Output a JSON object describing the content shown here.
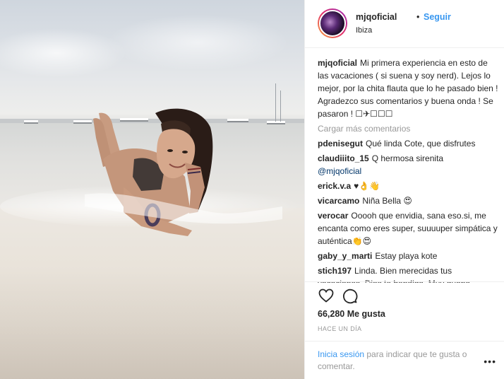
{
  "header": {
    "username": "mjqoficial",
    "separator": "•",
    "follow_label": "Seguir",
    "location": "Ibiza"
  },
  "caption": {
    "username": "mjqoficial",
    "text": "Mi primera experiencia en esto de las vacaciones ( si suena y soy nerd). Lejos lo mejor, por la chita flauta que lo he pasado bien ! Agradezco sus comentarios y buena onda ! Se pasaron ! ☐✈☐☐☐"
  },
  "load_more_label": "Cargar más comentarios",
  "comments": [
    {
      "username": "pdenisegut",
      "text": "Qué linda Cote, que disfrutes",
      "mention": ""
    },
    {
      "username": "claudiiito_15",
      "text": "Q hermosa sirenita",
      "mention": "@mjqoficial"
    },
    {
      "username": "erick.v.a",
      "text": "♥👌👋",
      "mention": ""
    },
    {
      "username": "vicarcamo",
      "text": "Niña Bella 😍",
      "mention": ""
    },
    {
      "username": "verocar",
      "text": "Ooooh que envidia, sana eso.si, me encanta como eres super, suuuuper simpática y auténtica👏😍",
      "mention": ""
    },
    {
      "username": "gaby_y_marti",
      "text": "Estay playa kote",
      "mention": ""
    },
    {
      "username": "stich197",
      "text": "Linda. Bien merecidas tus vacaciones. Dios te bendiga. Muy guapa.",
      "mention": ""
    }
  ],
  "actions": {
    "like_icon": "heart-icon",
    "comment_icon": "comment-icon"
  },
  "likes": "66,280 Me gusta",
  "timestamp": "HACE UN DÍA",
  "footer": {
    "login_label": "Inicia sesión",
    "rest_text": " para indicar que te gusta o comentar.",
    "more_label": "•••"
  },
  "colors": {
    "link_blue": "#3897f0",
    "mention_blue": "#003569",
    "muted": "#999999",
    "text": "#262626"
  }
}
